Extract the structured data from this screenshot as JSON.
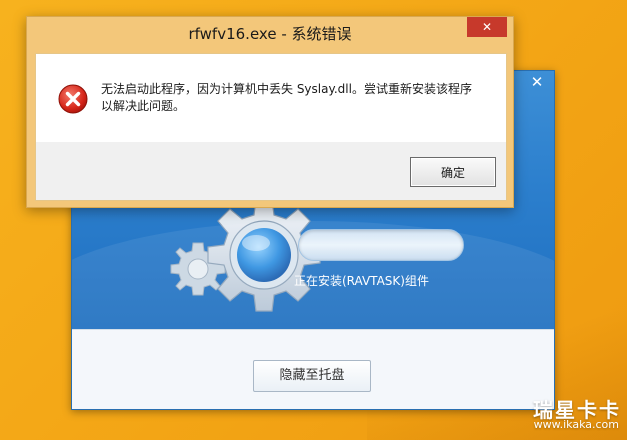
{
  "error_dialog": {
    "title": "rfwfv16.exe - 系统错误",
    "close_label": "✕",
    "message_line1": "无法启动此程序，因为计算机中丢失 Syslay.dll。尝试重新安装该程序",
    "message_line2": "以解决此问题。",
    "ok_label": "确定",
    "icon": "error-icon"
  },
  "installer": {
    "close_label": "✕",
    "status_text": "正在安装(RAVTASK)组件",
    "tray_button_label": "隐藏至托盘",
    "progress_value": 0
  },
  "watermark": {
    "logo_text": "瑞星卡卡",
    "url_text": "www.ikaka.com"
  }
}
